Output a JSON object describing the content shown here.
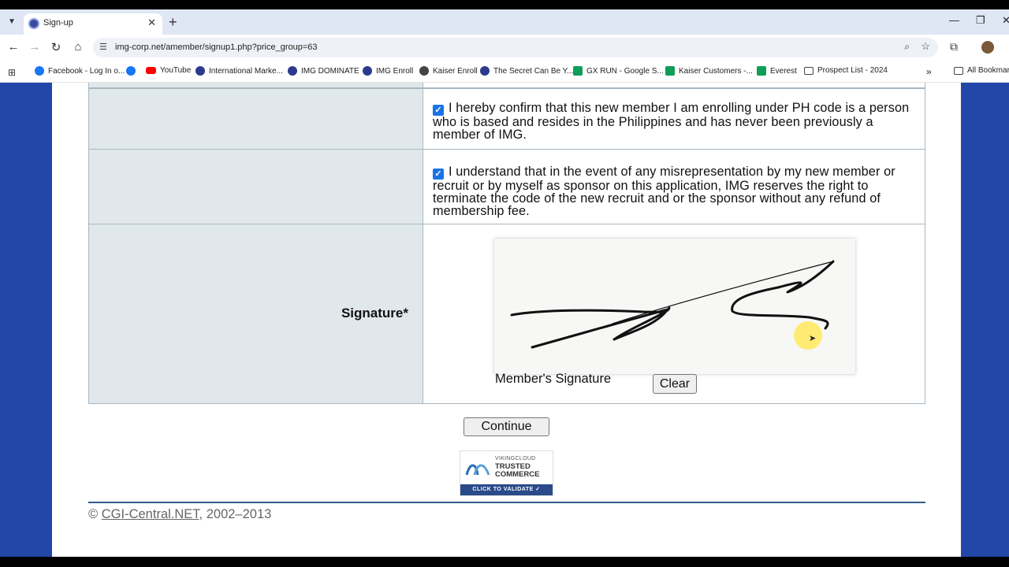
{
  "browser": {
    "tab_title": "Sign-up",
    "url": "img-corp.net/amember/signup1.php?price_group=63",
    "bookmarks": [
      {
        "label": "Facebook - Log In o...",
        "icon": "facebook-icon"
      },
      {
        "label": "",
        "icon": "facebook-icon"
      },
      {
        "label": "YouTube",
        "icon": "youtube-icon"
      },
      {
        "label": "International Marke...",
        "icon": "img-icon"
      },
      {
        "label": "IMG DOMINATE",
        "icon": "img-icon"
      },
      {
        "label": "IMG Enroll",
        "icon": "img-icon"
      },
      {
        "label": "Kaiser Enroll",
        "icon": "kaiser-icon"
      },
      {
        "label": "The Secret Can Be Y...",
        "icon": "img-icon"
      },
      {
        "label": "GX RUN - Google S...",
        "icon": "google-sheets-icon"
      },
      {
        "label": "Kaiser Customers -...",
        "icon": "google-sheets-icon"
      },
      {
        "label": "Everest",
        "icon": "google-sheets-icon"
      },
      {
        "label": "Prospect List - 2024",
        "icon": "folder-icon"
      }
    ],
    "all_bookmarks": "All Bookmark"
  },
  "form": {
    "confirm_text": "I hereby confirm that this new member I am enrolling under PH code is a person who is based and resides in the Philippines and has never been previously a member of IMG.",
    "understand_text": "I understand that in the event of any misrepresentation by my new member or recruit or by myself as sponsor on this application, IMG reserves the right to terminate the code of the new recruit and or the sponsor without any refund of membership fee.",
    "signature_label": "Signature*",
    "signature_caption": "Member's Signature",
    "clear_label": "Clear",
    "continue_label": "Continue"
  },
  "trust_badge": {
    "brand": "VIKINGCLOUD",
    "title": "TRUSTED COMMERCE",
    "cta": "CLICK TO VALIDATE ✓"
  },
  "footer": {
    "copyright_symbol": "©",
    "link_text": "CGI-Central.NET",
    "years": ", 2002–2013"
  },
  "colors": {
    "page_background": "#2247a8",
    "label_cell": "#e1e8eb",
    "checkbox": "#1a73e8"
  }
}
